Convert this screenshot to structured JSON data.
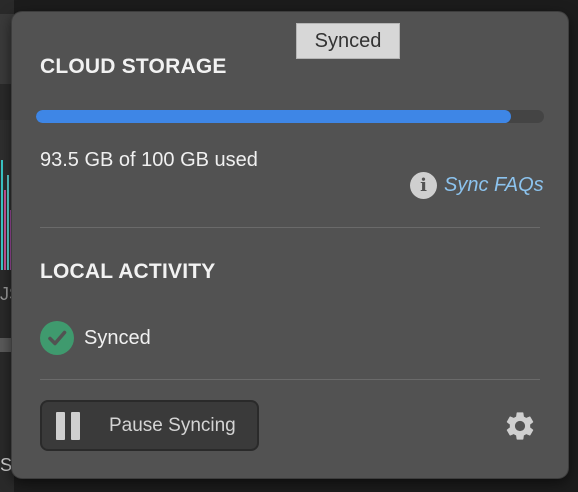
{
  "tooltip": {
    "text": "Synced"
  },
  "cloud_storage": {
    "title": "CLOUD STORAGE",
    "usage_text": "93.5 GB of 100 GB used",
    "used_fraction": 0.935,
    "bar_color": "#3e86e6",
    "faq_icon": "info-icon",
    "faq_link": "Sync FAQs"
  },
  "local_activity": {
    "title": "LOCAL ACTIVITY",
    "status_icon": "check-circle-icon",
    "status_text": "Synced"
  },
  "footer": {
    "pause_icon": "pause-icon",
    "pause_label": "Pause Syncing",
    "settings_icon": "gear-icon"
  },
  "background": {
    "partial_text_1": "JS",
    "partial_text_2": "S"
  }
}
